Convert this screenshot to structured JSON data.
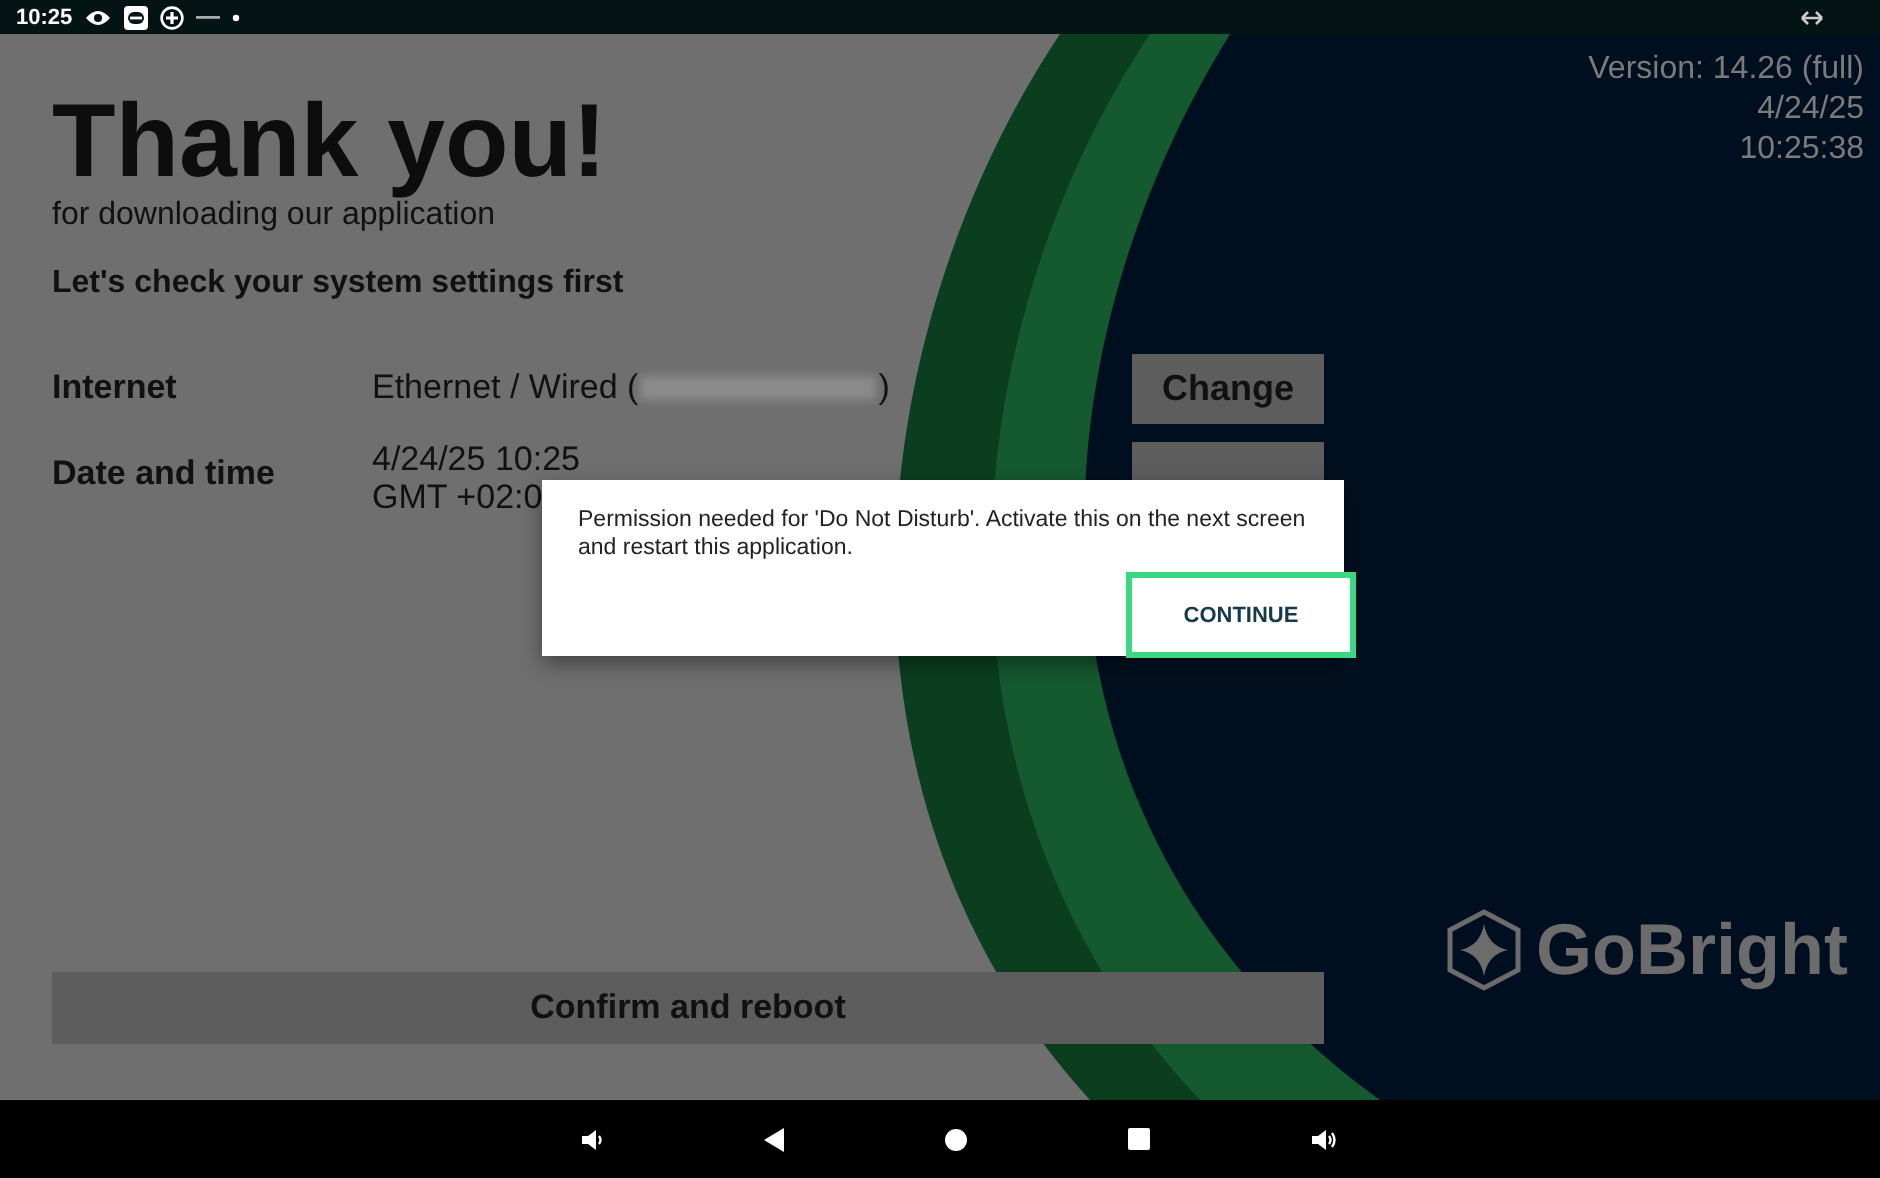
{
  "status_bar": {
    "time": "10:25"
  },
  "version": {
    "version": "Version: 14.26 (full)",
    "date": "4/24/25",
    "time": "10:25:38"
  },
  "header": {
    "title": "Thank you!",
    "subtitle": "for downloading our application",
    "prompt": "Let's check your system settings first"
  },
  "settings": [
    {
      "kind": "internet",
      "label": "Internet",
      "value_prefix": "Ethernet / Wired (",
      "value_suffix": ")",
      "button": "Change"
    },
    {
      "kind": "datetime",
      "label": "Date and time",
      "lines": [
        "4/24/25 10:25",
        "GMT +02:0"
      ]
    }
  ],
  "confirm_button": "Confirm and reboot",
  "logo": {
    "text": "GoBright"
  },
  "dialog": {
    "message": "Permission needed for 'Do Not Disturb'. Activate this on the next screen and restart this application.",
    "button": "CONTINUE",
    "button_focused": true
  }
}
